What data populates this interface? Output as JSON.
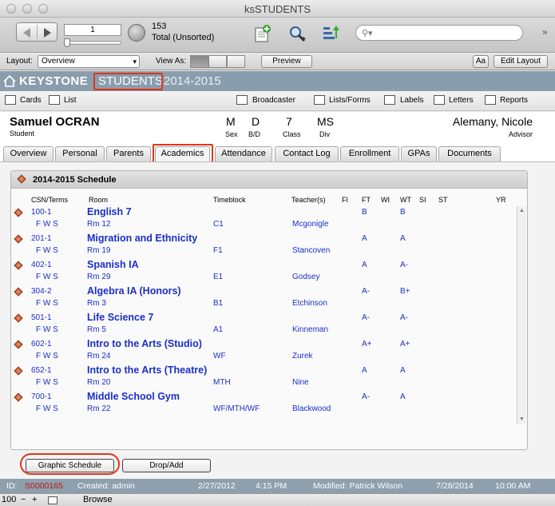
{
  "window": {
    "title": "ksSTUDENTS"
  },
  "toolbar": {
    "record_number": "1",
    "record_count": "153",
    "record_total_label": "Total (Unsorted)",
    "search_placeholder": ""
  },
  "layoutbar": {
    "layout_label": "Layout:",
    "layout_value": "Overview",
    "view_as_label": "View As:",
    "preview_label": "Preview",
    "aa_label": "Aa",
    "edit_layout_label": "Edit Layout"
  },
  "header": {
    "logo_text": "KEYSTONE",
    "module": "STUDENTS",
    "year": "2014-2015"
  },
  "nav": {
    "cards": "Cards",
    "list": "List",
    "broadcaster": "Broadcaster",
    "lists_forms": "Lists/Forms",
    "labels": "Labels",
    "letters": "Letters",
    "reports": "Reports"
  },
  "student": {
    "name": "Samuel OCRAN",
    "role": "Student",
    "sex": "M",
    "sex_label": "Sex",
    "bd": "D",
    "bd_label": "B/D",
    "class": "7",
    "class_label": "Class",
    "div": "MS",
    "div_label": "Div",
    "advisor": "Alemany, Nicole",
    "advisor_label": "Advisor"
  },
  "tabs": [
    "Overview",
    "Personal",
    "Parents",
    "Academics",
    "Attendance",
    "Contact Log",
    "Enrollment",
    "GPAs",
    "Documents"
  ],
  "schedule": {
    "title": "2014-2015 Schedule",
    "columns": [
      "CSN/Terms",
      "Room",
      "Timeblock",
      "Teacher(s)",
      "FI",
      "FT",
      "WI",
      "WT",
      "SI",
      "ST",
      "YR"
    ],
    "rows": [
      {
        "csn": "100-1",
        "course": "English 7",
        "terms": "F W S",
        "room": "Rm 12",
        "timeblock": "C1",
        "teacher": "Mcgonigle",
        "ft": "B",
        "wt": "B"
      },
      {
        "csn": "201-1",
        "course": "Migration and Ethnicity",
        "terms": "F W S",
        "room": "Rm 19",
        "timeblock": "F1",
        "teacher": "Stancoven",
        "ft": "A",
        "wt": "A"
      },
      {
        "csn": "402-1",
        "course": "Spanish IA",
        "terms": "F W S",
        "room": "Rm 29",
        "timeblock": "E1",
        "teacher": "Godsey",
        "ft": "A",
        "wt": "A-"
      },
      {
        "csn": "304-2",
        "course": "Algebra IA (Honors)",
        "terms": "F W S",
        "room": "Rm 3",
        "timeblock": "B1",
        "teacher": "Etchinson",
        "ft": "A-",
        "wt": "B+"
      },
      {
        "csn": "501-1",
        "course": "Life Science 7",
        "terms": "F W S",
        "room": "Rm 5",
        "timeblock": "A1",
        "teacher": "Kinneman",
        "ft": "A-",
        "wt": "A-"
      },
      {
        "csn": "602-1",
        "course": "Intro to the Arts (Studio)",
        "terms": "F W S",
        "room": "Rm 24",
        "timeblock": "WF",
        "teacher": "Zurek",
        "ft": "A+",
        "wt": "A+"
      },
      {
        "csn": "652-1",
        "course": "Intro to the Arts (Theatre)",
        "terms": "F W S",
        "room": "Rm 20",
        "timeblock": "MTH",
        "teacher": "Nine",
        "ft": "A",
        "wt": "A"
      },
      {
        "csn": "700-1",
        "course": "Middle School Gym",
        "terms": "F W S",
        "room": "Rm 22",
        "timeblock": "WF/MTH/WF",
        "teacher": "Blackwood",
        "ft": "A-",
        "wt": "A"
      }
    ]
  },
  "buttons": {
    "graphic_schedule": "Graphic Schedule",
    "drop_add": "Drop/Add"
  },
  "status": {
    "id_label": "ID:",
    "id_value": "S0000165",
    "created": "Created: admin",
    "created_date": "2/27/2012",
    "created_time": "4:15 PM",
    "modified": "Modified: Patrick Wilson",
    "modified_date": "7/28/2014",
    "modified_time": "10:00 AM"
  },
  "bottom": {
    "zoom": "100",
    "mode": "Browse"
  }
}
